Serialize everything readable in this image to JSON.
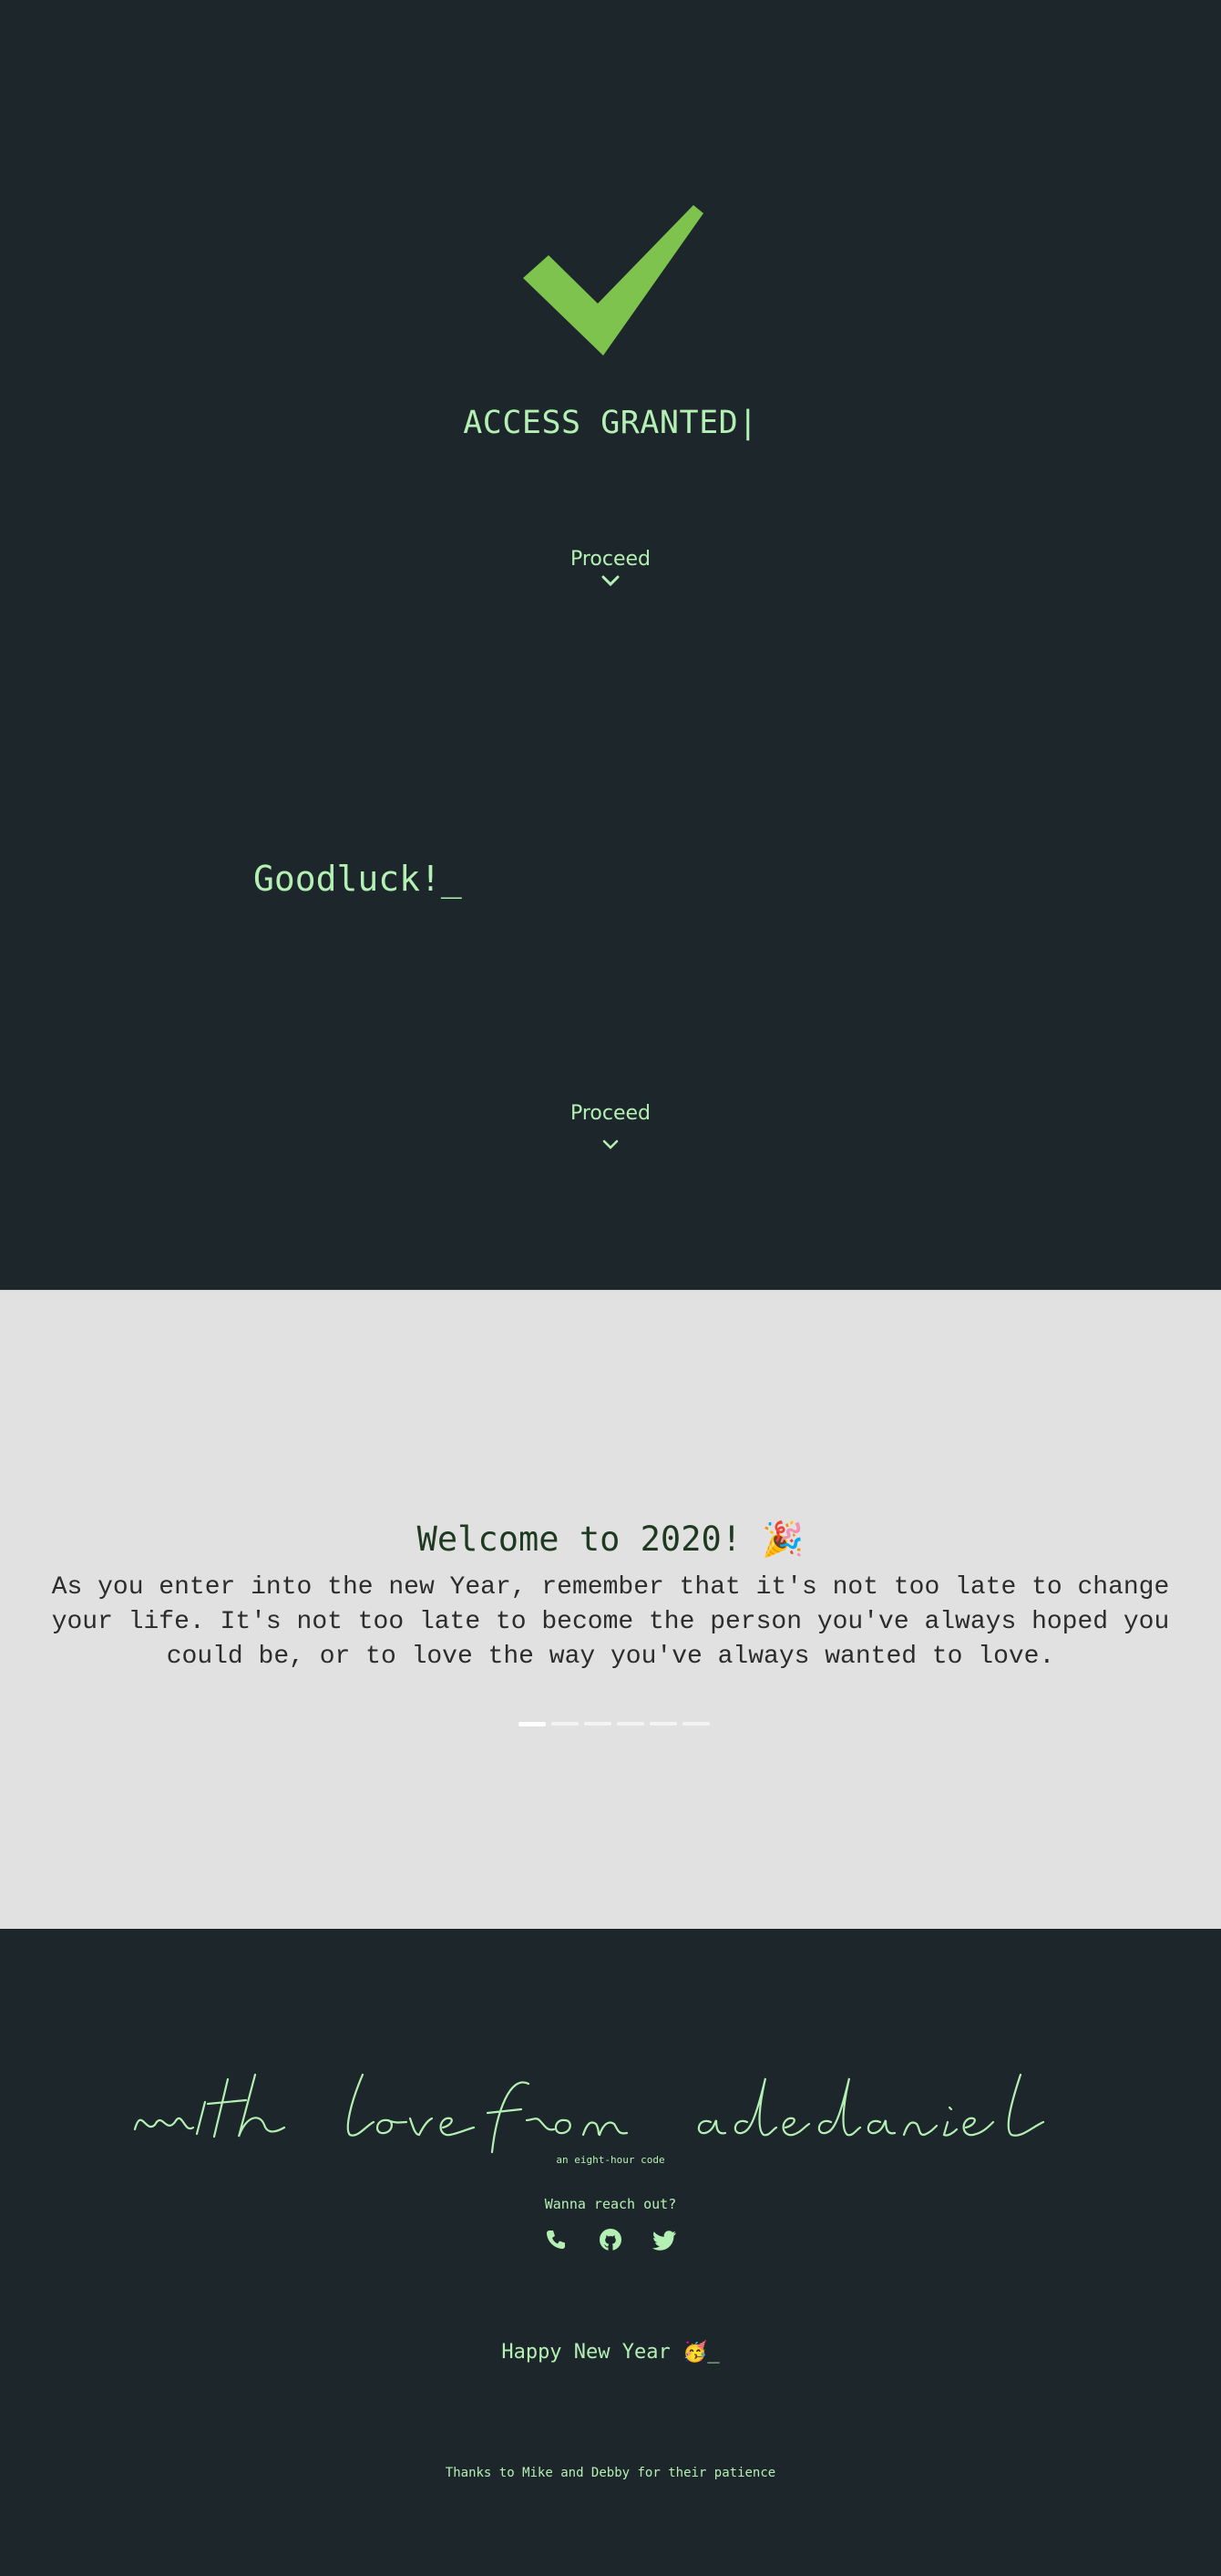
{
  "hero": {
    "icon": "checkmark-icon",
    "title": "ACCESS GRANTED|",
    "proceed_label": "Proceed",
    "accent_color": "#7dc34d"
  },
  "goodluck": {
    "text": "Goodluck!_",
    "proceed_label": "Proceed"
  },
  "welcome": {
    "title": "Welcome to 2020! 🎉",
    "body": "As you enter into the new Year, remember that it's not too late to change your life. It's not too late to become the person you've always hoped you could be, or to love the way you've always wanted to love.",
    "slides": 6,
    "active_slide": 1
  },
  "footer": {
    "signature": "with love from adedaniel",
    "tagline": "an eight-hour code",
    "reach_out": "Wanna reach out?",
    "socials": [
      "phone-icon",
      "github-icon",
      "twitter-icon"
    ],
    "new_year": "Happy New Year 🥳_",
    "thanks": "Thanks to Mike and Debby for their patience"
  }
}
